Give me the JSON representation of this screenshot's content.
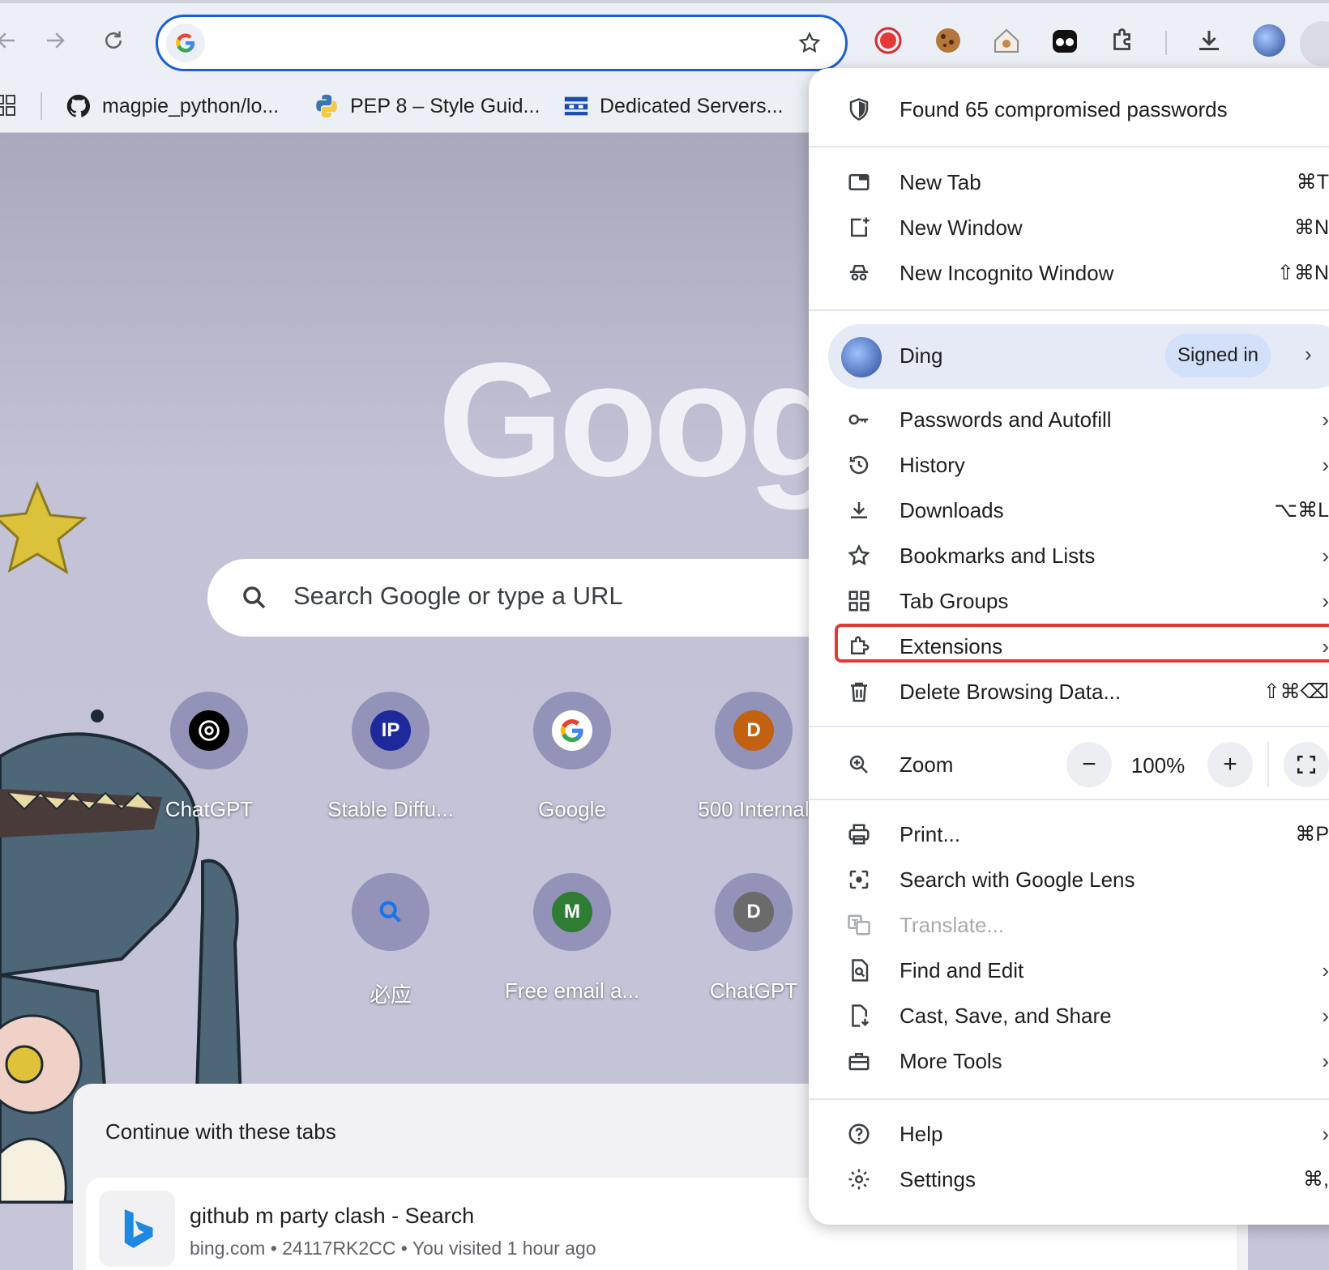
{
  "toolbar": {
    "omnibox_value": "",
    "extensions": [
      "record-icon",
      "cookie-icon",
      "cookie-house-icon",
      "ghost-icon",
      "puzzle-icon"
    ]
  },
  "bookmarks": [
    {
      "label": "magpie_python/lo...",
      "icon": "github-icon"
    },
    {
      "label": "PEP 8 – Style Guid...",
      "icon": "python-icon"
    },
    {
      "label": "Dedicated Servers...",
      "icon": "server-icon"
    }
  ],
  "ntp": {
    "logo": "Googl",
    "search_placeholder": "Search Google or type a URL",
    "shortcuts": [
      {
        "label": "ChatGPT",
        "badge": "",
        "color": "#000000"
      },
      {
        "label": "Stable Diffu...",
        "badge": "IP",
        "color": "#1e2a9c"
      },
      {
        "label": "Google",
        "badge": "G",
        "color": "#ffffff"
      },
      {
        "label": "500 Internal",
        "badge": "D",
        "color": "#c2610f"
      },
      {
        "label": "必应",
        "badge": "",
        "color": "#9392b8"
      },
      {
        "label": "Free email a...",
        "badge": "M",
        "color": "#2e7d32"
      },
      {
        "label": "ChatGPT",
        "badge": "D",
        "color": "#6b6b6b"
      }
    ],
    "continue_title": "Continue with these tabs",
    "tab_title": "github m party clash - Search",
    "tab_meta": "bing.com • 24117RK2CC • You visited 1 hour ago"
  },
  "menu": {
    "compromised": "Found 65 compromised passwords",
    "new_tab": {
      "label": "New Tab",
      "shortcut": "⌘T"
    },
    "new_window": {
      "label": "New Window",
      "shortcut": "⌘N"
    },
    "incognito": {
      "label": "New Incognito Window",
      "shortcut": "⇧⌘N"
    },
    "profile": {
      "name": "Ding",
      "status": "Signed in"
    },
    "passwords": "Passwords and Autofill",
    "history": "History",
    "downloads": {
      "label": "Downloads",
      "shortcut": "⌥⌘L"
    },
    "bookmarks": "Bookmarks and Lists",
    "tab_groups": "Tab Groups",
    "extensions": "Extensions",
    "delete_data": {
      "label": "Delete Browsing Data...",
      "shortcut": "⇧⌘⌫"
    },
    "zoom": {
      "label": "Zoom",
      "value": "100%",
      "minus": "−",
      "plus": "+"
    },
    "print": {
      "label": "Print...",
      "shortcut": "⌘P"
    },
    "lens": "Search with Google Lens",
    "translate": "Translate...",
    "find_edit": "Find and Edit",
    "cast": "Cast, Save, and Share",
    "more_tools": "More Tools",
    "help": "Help",
    "settings": {
      "label": "Settings",
      "shortcut": "⌘,"
    }
  },
  "colors": {
    "accent": "#1a5fd6",
    "highlight": "#e53935"
  }
}
